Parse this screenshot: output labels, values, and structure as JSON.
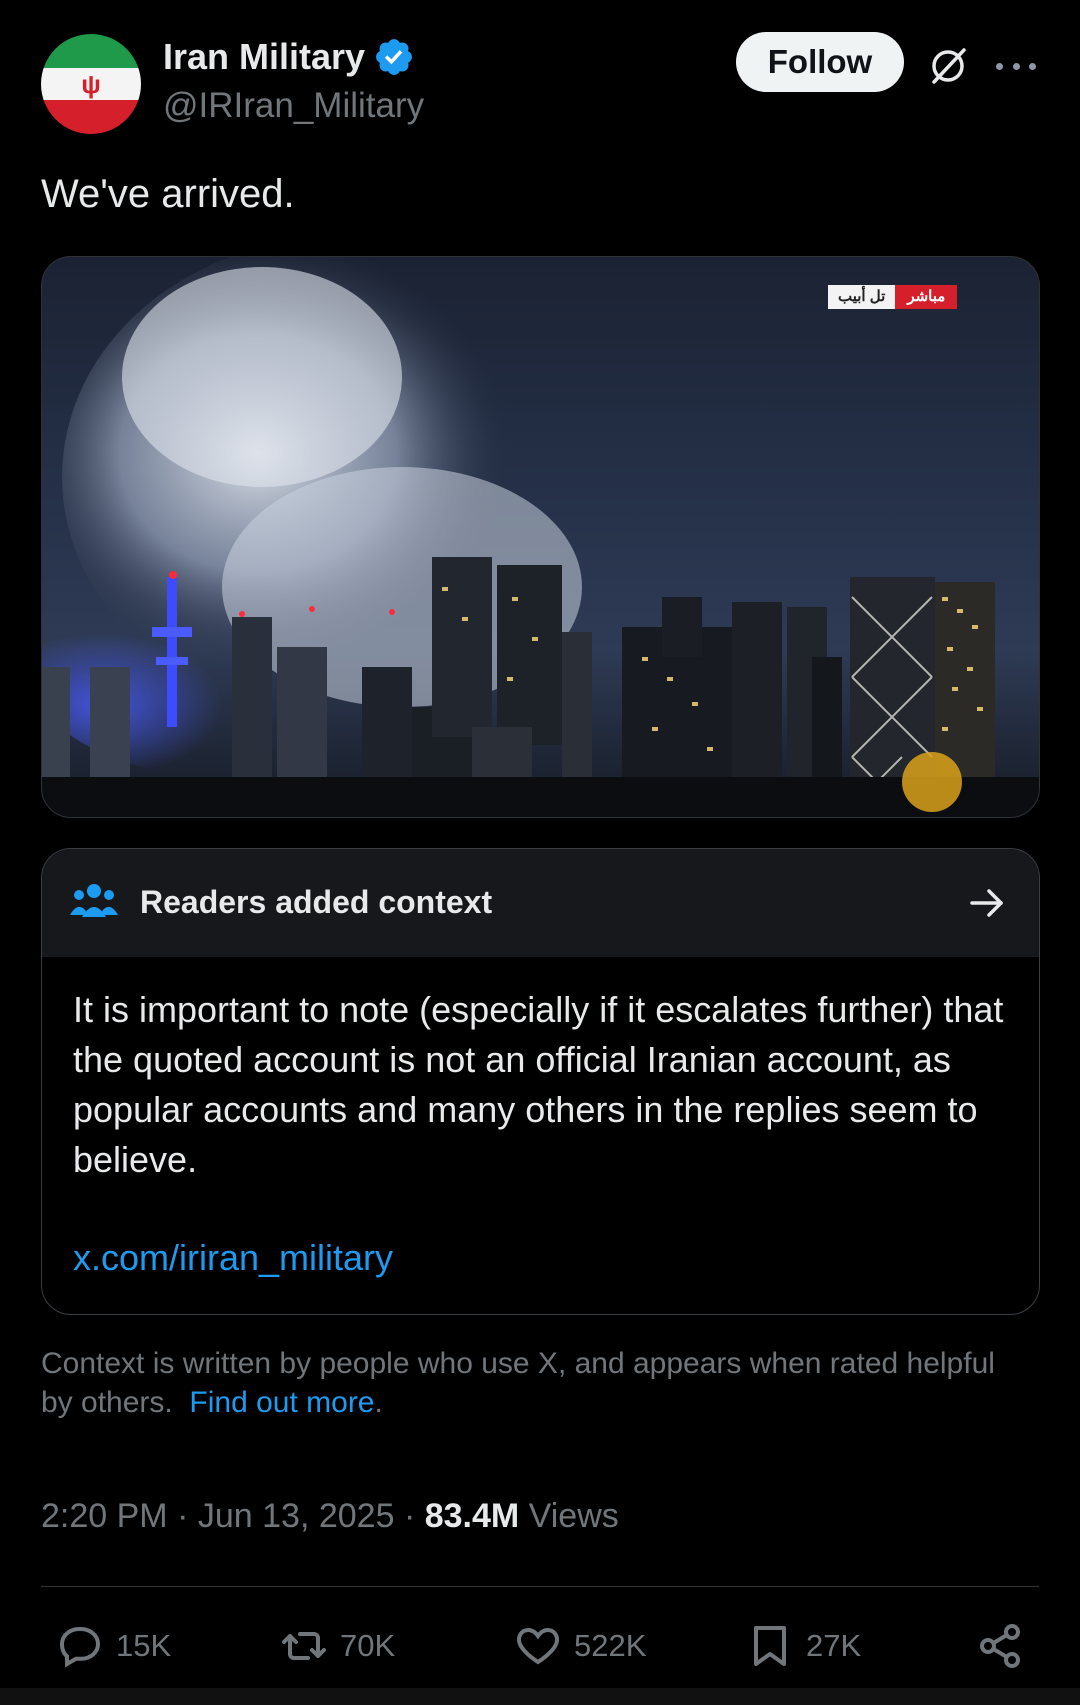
{
  "author": {
    "display_name": "Iran Military",
    "handle": "@IRIran_Military",
    "follow_label": "Follow"
  },
  "tweet": {
    "text": "We've arrived."
  },
  "media": {
    "overlay_text_location": "تل أبيب",
    "overlay_text_live": "مباشر"
  },
  "note": {
    "title": "Readers added context",
    "body": "It is important to note (especially if it escalates further) that the quoted account is not an official Iranian account, as popular accounts and many others in the replies seem to believe.",
    "link": "x.com/iriran_military"
  },
  "context_info": {
    "text": "Context is written by people who use X, and appears when rated helpful by others.",
    "link": "Find out more",
    "suffix": "."
  },
  "meta": {
    "time": "2:20 PM",
    "date": "Jun 13, 2025",
    "views_count": "83.4M",
    "views_label": "Views"
  },
  "actions": {
    "replies": "15K",
    "reposts": "70K",
    "likes": "522K",
    "bookmarks": "27K"
  },
  "colors": {
    "background": "#000000",
    "accent": "#1d9bf0",
    "muted": "#71767b",
    "note_header": "#16181c"
  },
  "icons": [
    "verified-badge-icon",
    "grok-icon",
    "more-icon",
    "people-icon",
    "arrow-right-icon",
    "reply-icon",
    "repost-icon",
    "like-icon",
    "bookmark-icon",
    "share-icon"
  ]
}
